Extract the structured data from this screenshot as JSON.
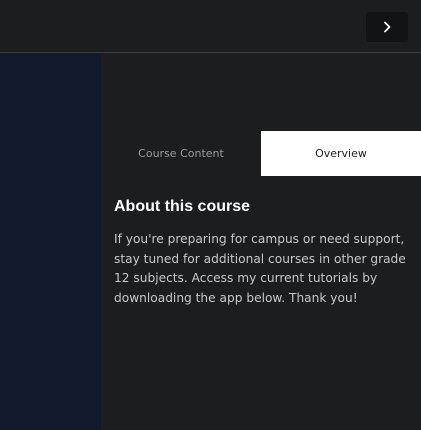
{
  "header": {
    "next_button_icon": "chevron-right-icon"
  },
  "tabs": [
    {
      "label": "Course Content",
      "active": false
    },
    {
      "label": "Overview",
      "active": true
    }
  ],
  "overview": {
    "title": "About this course",
    "description": "If you're preparing for campus or need support, stay tuned for additional courses in other grade 12 subjects. Access my current tutorials by downloading the app below. Thank you!"
  },
  "colors": {
    "background": "#1c1d1f",
    "side_panel": "#101a2c",
    "active_tab_bg": "#ffffff",
    "inactive_tab_text": "#9a9ca1"
  }
}
